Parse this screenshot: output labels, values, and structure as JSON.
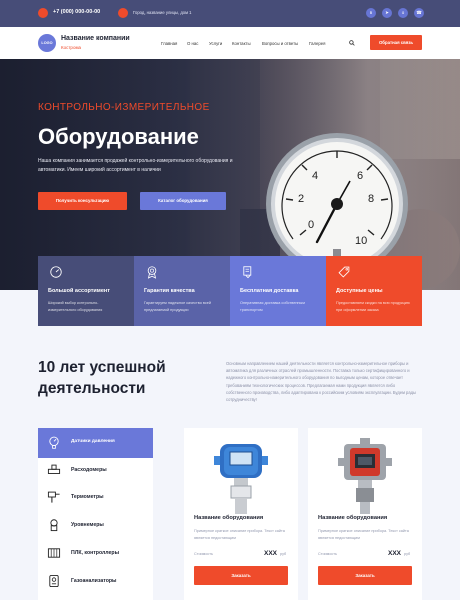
{
  "topbar": {
    "phone": "+7 (000) 000-00-00",
    "address": "Город, название улицы, дом 1",
    "social": [
      "vk-icon",
      "telegram-icon",
      "ok-icon",
      "whatsapp-icon"
    ]
  },
  "header": {
    "logo": "LOGO",
    "company": "Название компании",
    "city": "Кострома",
    "nav": [
      "Главная",
      "О нас",
      "Услуги",
      "Контакты",
      "Вопросы и ответы",
      "Галерея"
    ],
    "callback": "Обратная связь"
  },
  "hero": {
    "subtitle": "КОНТРОЛЬНО-ИЗМЕРИТЕЛЬНОЕ",
    "title": "Оборудование",
    "text": "Наша компания занимается продажей контрольно-измерительного оборудования и автоматики. Имеем широкий ассортимент в наличии",
    "primary_button": "Получить консультацию",
    "secondary_button": "Каталог оборудования",
    "gauge_ticks": [
      "0",
      "2",
      "4",
      "6",
      "8",
      "10"
    ]
  },
  "features": [
    {
      "title": "Большой ассортимент",
      "text": "Широкий выбор контрольно-измерительного оборудования",
      "color": "#474d78"
    },
    {
      "title": "Гарантия качества",
      "text": "Гарантируем надежное качество всей предлагаемой продукции",
      "color": "#5a63a8"
    },
    {
      "title": "Бесплатная доставка",
      "text": "Оперативная доставка собственным транспортом",
      "color": "#6a78d9"
    },
    {
      "title": "Доступные цены",
      "text": "Предоставляем скидки на всю продукцию при оформлении заказа",
      "color": "#ef4b2b"
    }
  ],
  "about": {
    "title": "10 лет успешной деятельности",
    "text": "Основным направлением нашей деятельности является контрольно-измерительное приборы и автоматика для различных отраслей промышленности. Поставка только сертифицированного и надежного контрольно-измерительного оборудования по выгодным ценам, которое отвечает требованиям технологических процессов. Предлагаемая нами продукция является либо собственного производства, либо адаптирована к российским условиям эксплуатации. Будем рады сотрудничеству!"
  },
  "catalog": {
    "items": [
      "Датчики давления",
      "Расходомеры",
      "Термометры",
      "Уровнемеры",
      "ПЛК, контроллеры",
      "Газоанализаторы"
    ],
    "active_index": 0
  },
  "products": [
    {
      "name": "Название оборудования",
      "description": "Примерное краткое описание прибора. Текст сайта является недостающим",
      "price_label": "Стоимость",
      "price": "ХХХ",
      "unit": "руб",
      "button": "Заказать"
    },
    {
      "name": "Название оборудования",
      "description": "Примерное краткое описание прибора. Текст сайта является недостающим",
      "price_label": "Стоимость",
      "price": "ХХХ",
      "unit": "руб",
      "button": "Заказать"
    }
  ],
  "colors": {
    "accent": "#ef4b2b",
    "primary": "#6a78d9",
    "dark": "#474d78"
  }
}
